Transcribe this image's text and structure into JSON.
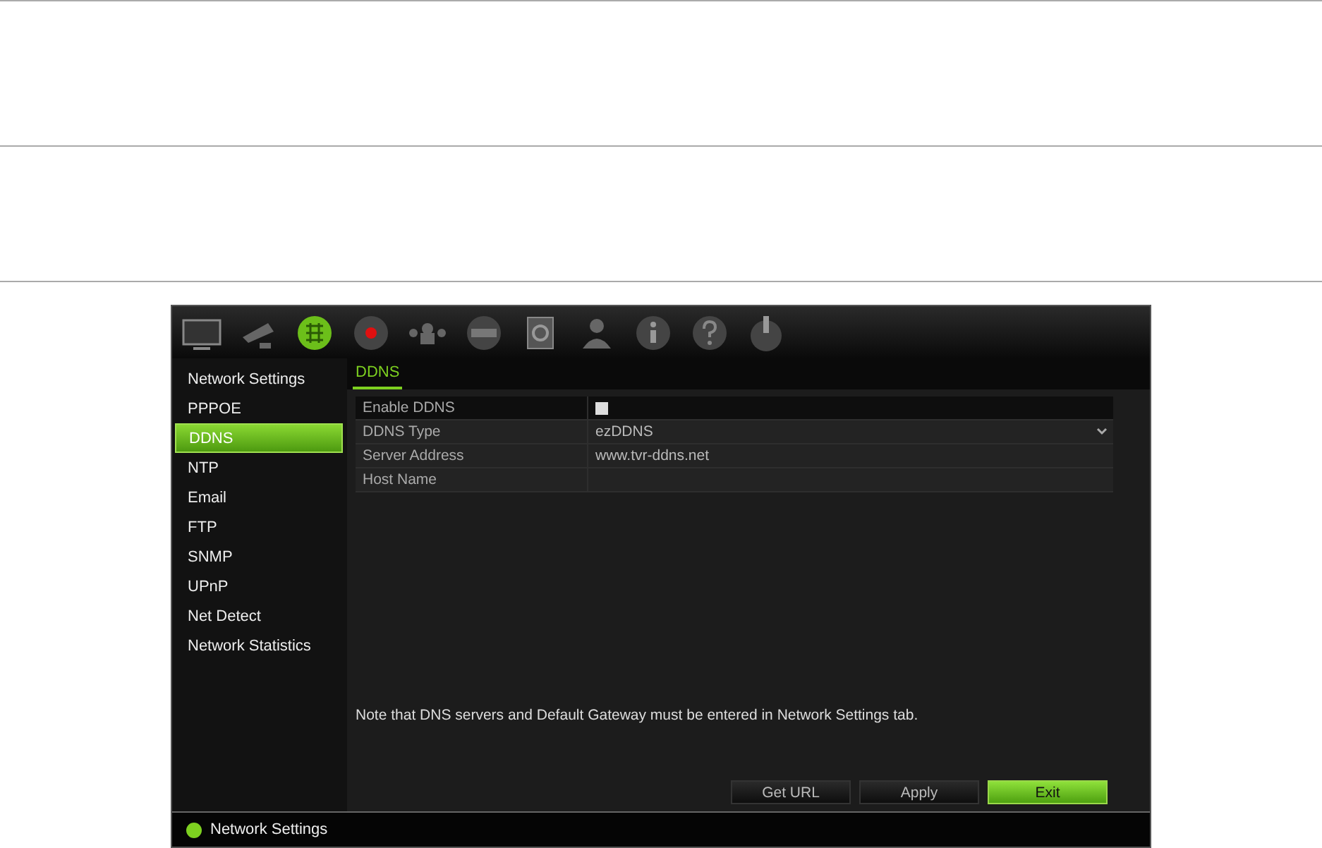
{
  "toolbar": [
    {
      "kind": "monitor",
      "selected": false
    },
    {
      "kind": "camera",
      "selected": false
    },
    {
      "kind": "network",
      "selected": true
    },
    {
      "kind": "record",
      "selected": false
    },
    {
      "kind": "alarm",
      "selected": false
    },
    {
      "kind": "device",
      "selected": false
    },
    {
      "kind": "disk",
      "selected": false
    },
    {
      "kind": "user",
      "selected": false
    },
    {
      "kind": "info",
      "selected": false
    },
    {
      "kind": "help",
      "selected": false
    },
    {
      "kind": "power",
      "selected": false
    }
  ],
  "sidebar": {
    "items": [
      {
        "label": "Network Settings",
        "selected": false
      },
      {
        "label": "PPPOE",
        "selected": false
      },
      {
        "label": "DDNS",
        "selected": true
      },
      {
        "label": "NTP",
        "selected": false
      },
      {
        "label": "Email",
        "selected": false
      },
      {
        "label": "FTP",
        "selected": false
      },
      {
        "label": "SNMP",
        "selected": false
      },
      {
        "label": "UPnP",
        "selected": false
      },
      {
        "label": "Net Detect",
        "selected": false
      },
      {
        "label": "Network Statistics",
        "selected": false
      }
    ]
  },
  "tabs": [
    {
      "label": "DDNS",
      "selected": true
    }
  ],
  "form": [
    {
      "kind": "checkbox",
      "label": "Enable DDNS",
      "checked": false
    },
    {
      "kind": "select",
      "label": "DDNS Type",
      "value": "ezDDNS"
    },
    {
      "kind": "text",
      "label": "Server Address",
      "value": "www.tvr-ddns.net"
    },
    {
      "kind": "text",
      "label": "Host Name"
    }
  ],
  "note": "Note that DNS servers and Default Gateway must be entered in Network Settings tab.",
  "buttons": [
    {
      "label": "Get URL",
      "kind": "normal"
    },
    {
      "label": "Apply",
      "kind": "normal"
    },
    {
      "label": "Exit",
      "kind": "primary"
    }
  ],
  "status_bar": {
    "text": "Network Settings"
  }
}
